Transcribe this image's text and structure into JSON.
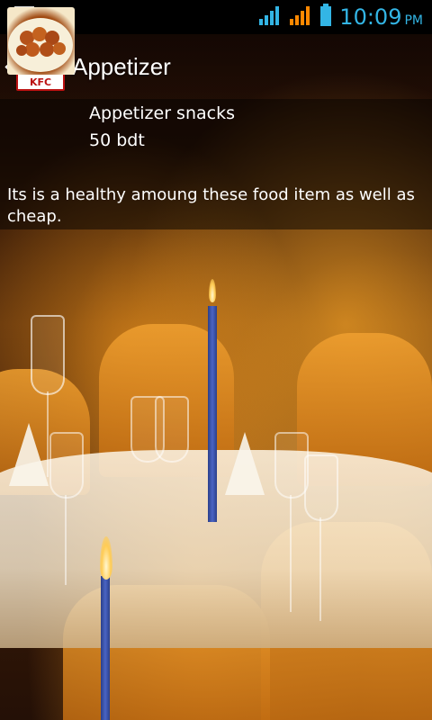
{
  "status_bar": {
    "time": "10:09",
    "ampm": "PM",
    "icons": [
      "image-notification-icon",
      "warning-icon",
      "wifi-signal-icon",
      "cell-signal-icon",
      "battery-icon"
    ]
  },
  "action_bar": {
    "title": "Appetizer",
    "logo_text": "KFC"
  },
  "item": {
    "name": "Appetizer snacks",
    "price": "50 bdt",
    "description": "Its is a healthy amoung these food item as well as cheap."
  },
  "colors": {
    "status_accent": "#33b5e5",
    "signal_orange": "#ff8800",
    "logo_red": "#bb1111"
  }
}
